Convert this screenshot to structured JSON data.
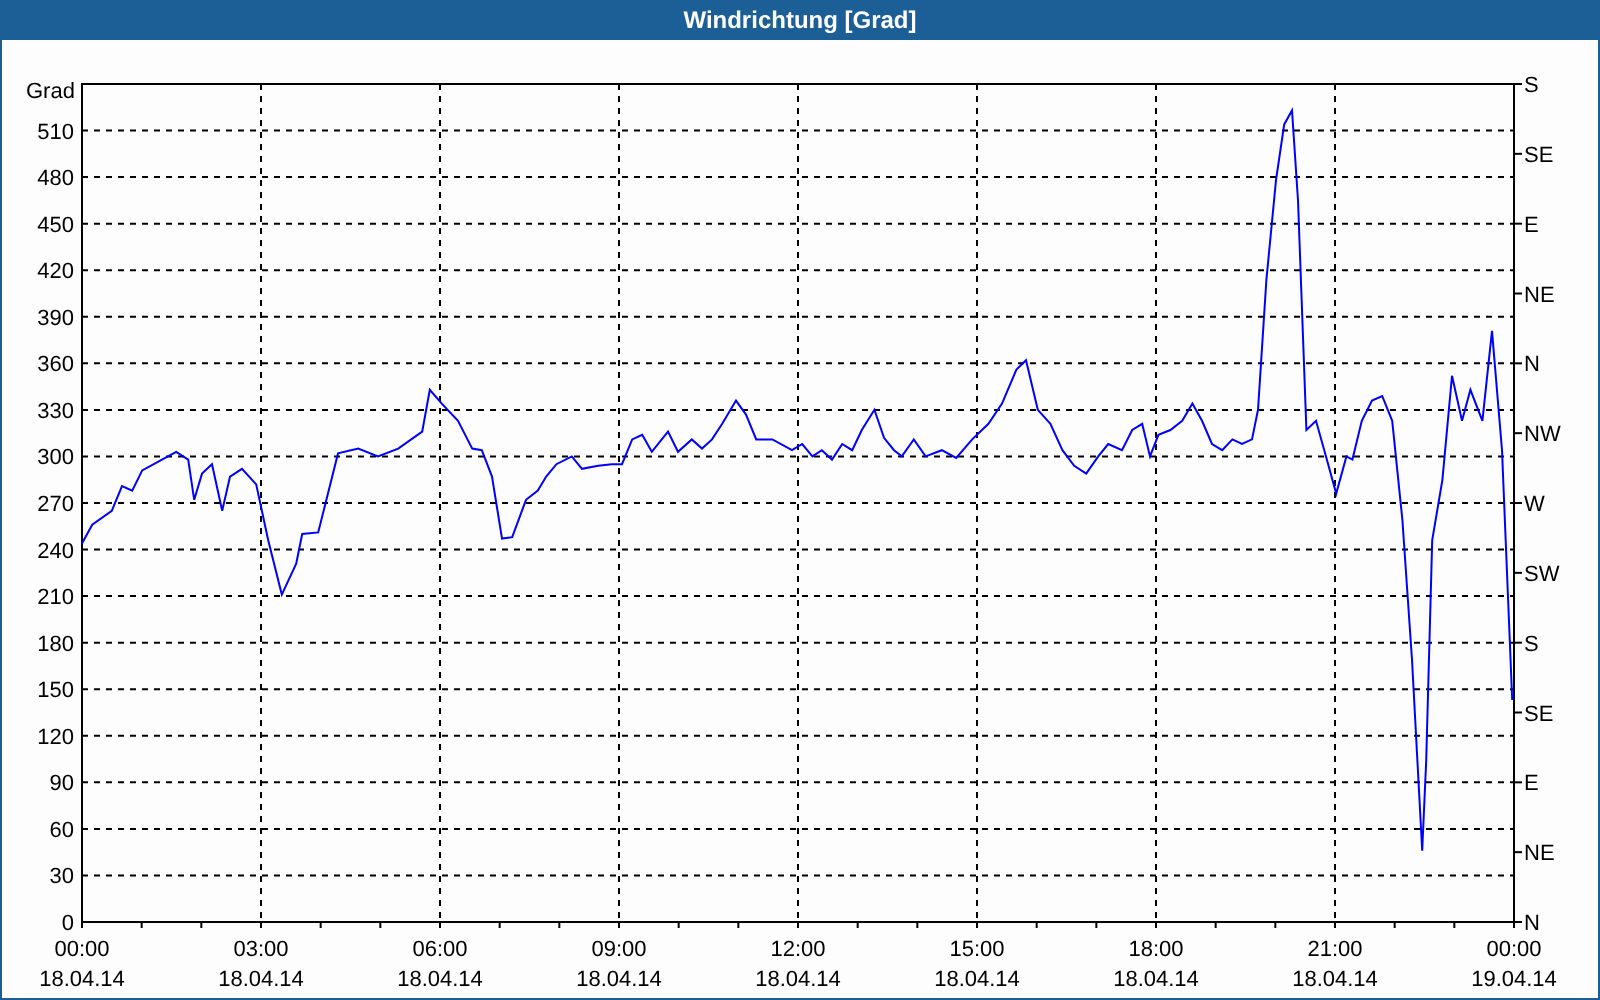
{
  "window": {
    "title": "Windrichtung [Grad]"
  },
  "chart": {
    "chart_data": {
      "type": "line",
      "grid": true,
      "ylabel": "Grad",
      "xlim": [
        0,
        24
      ],
      "ylim": [
        0,
        540
      ],
      "xticks": [
        {
          "value": 0,
          "label": "00:00"
        },
        {
          "value": 3,
          "label": "03:00"
        },
        {
          "value": 6,
          "label": "06:00"
        },
        {
          "value": 9,
          "label": "09:00"
        },
        {
          "value": 12,
          "label": "12:00"
        },
        {
          "value": 15,
          "label": "15:00"
        },
        {
          "value": 18,
          "label": "18:00"
        },
        {
          "value": 21,
          "label": "21:00"
        },
        {
          "value": 24,
          "label": "00:00"
        }
      ],
      "yticks": [
        0,
        30,
        60,
        90,
        120,
        150,
        180,
        210,
        240,
        270,
        300,
        330,
        360,
        390,
        420,
        450,
        480,
        510
      ],
      "x": [
        0,
        0.17,
        0.5,
        0.67,
        0.84,
        1.01,
        1.34,
        1.58,
        1.78,
        1.88,
        2.01,
        2.18,
        2.35,
        2.48,
        2.68,
        2.92,
        3.12,
        3.35,
        3.59,
        3.69,
        3.96,
        4.29,
        4.63,
        4.96,
        5.3,
        5.7,
        5.83,
        6.03,
        6.3,
        6.54,
        6.7,
        6.87,
        7.04,
        7.21,
        7.44,
        7.64,
        7.78,
        7.95,
        8.21,
        8.38,
        8.65,
        8.88,
        9.05,
        9.22,
        9.39,
        9.55,
        9.82,
        9.99,
        10.22,
        10.39,
        10.56,
        10.73,
        10.96,
        11.13,
        11.3,
        11.57,
        11.9,
        12.07,
        12.24,
        12.4,
        12.57,
        12.74,
        12.91,
        13.07,
        13.28,
        13.44,
        13.61,
        13.74,
        13.94,
        14.14,
        14.41,
        14.65,
        14.92,
        15.19,
        15.42,
        15.66,
        15.82,
        16.02,
        16.23,
        16.43,
        16.63,
        16.83,
        17.03,
        17.2,
        17.43,
        17.6,
        17.77,
        17.9,
        18.04,
        18.24,
        18.44,
        18.61,
        18.77,
        18.94,
        19.11,
        19.28,
        19.44,
        19.61,
        19.71,
        19.85,
        20.01,
        20.15,
        20.28,
        20.38,
        20.52,
        20.68,
        20.85,
        21.02,
        21.19,
        21.29,
        21.45,
        21.62,
        21.79,
        21.96,
        22.13,
        22.29,
        22.46,
        22.53,
        22.63,
        22.8,
        22.96,
        23.13,
        23.27,
        23.47,
        23.63,
        23.8,
        23.97
      ],
      "series": [
        {
          "color": "#0000ff",
          "values": [
            244,
            256,
            265,
            281,
            278,
            291,
            298,
            303,
            298,
            272,
            289,
            295,
            265,
            287,
            292,
            282,
            246,
            211,
            231,
            250,
            251,
            302,
            305,
            300,
            305,
            316,
            343,
            334,
            323,
            305,
            304,
            287,
            247,
            248,
            272,
            278,
            287,
            295,
            300,
            292,
            294,
            295,
            295,
            311,
            314,
            303,
            316,
            303,
            311,
            305,
            311,
            321,
            336,
            327,
            311,
            311,
            304,
            308,
            300,
            304,
            298,
            308,
            304,
            317,
            330,
            312,
            304,
            300,
            311,
            300,
            304,
            299,
            311,
            321,
            334,
            356,
            362,
            330,
            321,
            304,
            294,
            289,
            300,
            308,
            304,
            317,
            321,
            300,
            314,
            317,
            323,
            334,
            323,
            308,
            304,
            311,
            308,
            311,
            330,
            414,
            478,
            514,
            523,
            465,
            317,
            323,
            300,
            276,
            300,
            298,
            323,
            336,
            339,
            323,
            259,
            169,
            46,
            104,
            246,
            285,
            352,
            323,
            343,
            323,
            381,
            304,
            143
          ]
        }
      ]
    },
    "x_dates": [
      "18.04.14",
      "18.04.14",
      "18.04.14",
      "18.04.14",
      "18.04.14",
      "18.04.14",
      "18.04.14",
      "18.04.14",
      "19.04.14"
    ],
    "compass_labels": [
      "S",
      "SE",
      "E",
      "NE",
      "N",
      "NW",
      "W",
      "SW",
      "S",
      "SE",
      "E",
      "NE",
      "N"
    ]
  }
}
